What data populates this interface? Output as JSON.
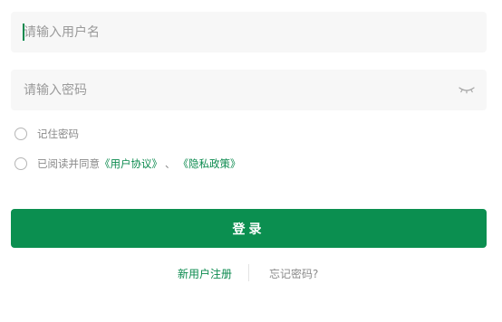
{
  "form": {
    "username_placeholder": "请输入用户名",
    "password_placeholder": "请输入密码",
    "password_toggle_icon": "eye-closed-icon",
    "remember_label": "记住密码",
    "remember_checked": false,
    "agree": {
      "prefix": "已阅读并同意",
      "terms_link": "《用户协议》",
      "separator": "、",
      "privacy_link": "《隐私政策》",
      "checked": false
    },
    "login_label": "登录"
  },
  "footer": {
    "register_label": "新用户注册",
    "forgot_label": "忘记密码?"
  },
  "colors": {
    "accent": "#0b8f50",
    "field_bg": "#f7f7f7",
    "muted_text": "#8a8a8a"
  }
}
